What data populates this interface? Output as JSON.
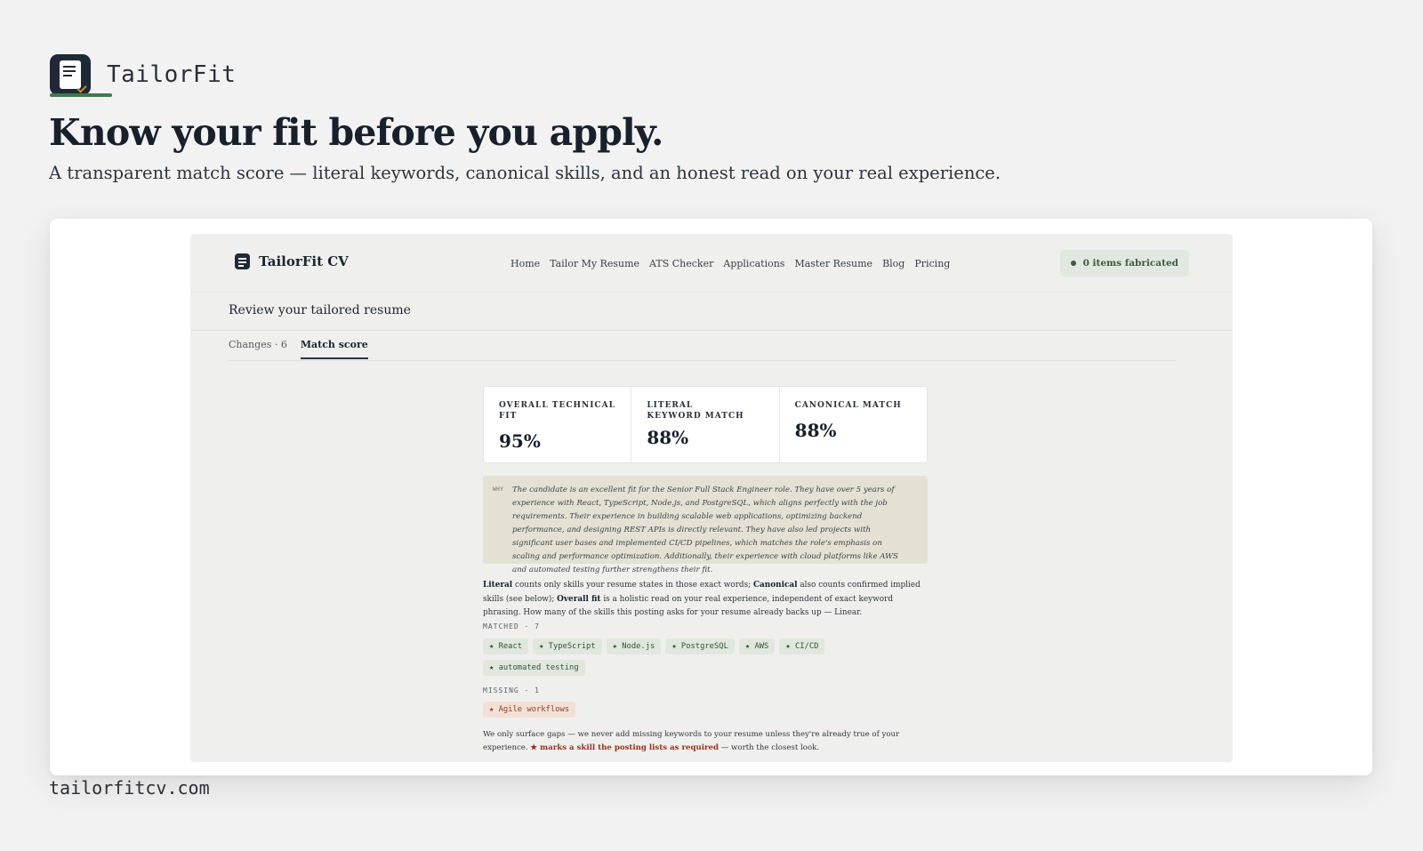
{
  "brand": {
    "name": "TailorFit"
  },
  "hero": {
    "title": "Know your fit before you apply.",
    "subtitle": "A transparent match score — literal keywords, canonical skills, and an honest read on your real experience."
  },
  "app": {
    "brand": "TailorFit CV",
    "nav": [
      "Home",
      "Tailor My Resume",
      "ATS Checker",
      "Applications",
      "Master Resume",
      "Blog",
      "Pricing"
    ],
    "badge": "0 items fabricated",
    "page_title": "Review your tailored resume",
    "tabs": [
      {
        "label": "Changes · 6",
        "active": false
      },
      {
        "label": "Match score",
        "active": true
      }
    ],
    "scores": [
      {
        "label": "OVERALL TECHNICAL FIT",
        "value": "95%"
      },
      {
        "label": "LITERAL KEYWORD MATCH",
        "value": "88%"
      },
      {
        "label": "CANONICAL MATCH",
        "value": "88%"
      }
    ],
    "why": {
      "tag": "WHY",
      "text": "The candidate is an excellent fit for the Senior Full Stack Engineer role. They have over 5 years of experience with React, TypeScript, Node.js, and PostgreSQL, which aligns perfectly with the job requirements. Their experience in building scalable web applications, optimizing backend performance, and designing REST APIs is directly relevant. They have also led projects with significant user bases and implemented CI/CD pipelines, which matches the role's emphasis on scaling and performance optimization. Additionally, their experience with cloud platforms like AWS and automated testing further strengthens their fit."
    },
    "explain": {
      "literal": "Literal",
      "t1": " counts only skills your resume states in those exact words; ",
      "canonical": "Canonical",
      "t2": " also counts confirmed implied skills (see below); ",
      "overall": "Overall fit",
      "t3": " is a holistic read on your real experience, independent of exact keyword phrasing. How many of the skills this posting asks for your resume already backs up — Linear."
    },
    "matched": {
      "label": "MATCHED · 7",
      "items": [
        "★ React",
        "★ TypeScript",
        "★ Node.js",
        "★ PostgreSQL",
        "★ AWS",
        "★ CI/CD",
        "★ automated testing"
      ]
    },
    "missing": {
      "label": "MISSING · 1",
      "items": [
        "★ Agile workflows"
      ]
    },
    "footnote": {
      "t1": "We only surface gaps — we never add missing keywords to your resume unless they're already true of your experience. ",
      "req": "★ marks a skill the posting lists as required",
      "t2": " — worth the closest look."
    }
  },
  "footer": {
    "domain": "tailorfitcv.com"
  }
}
